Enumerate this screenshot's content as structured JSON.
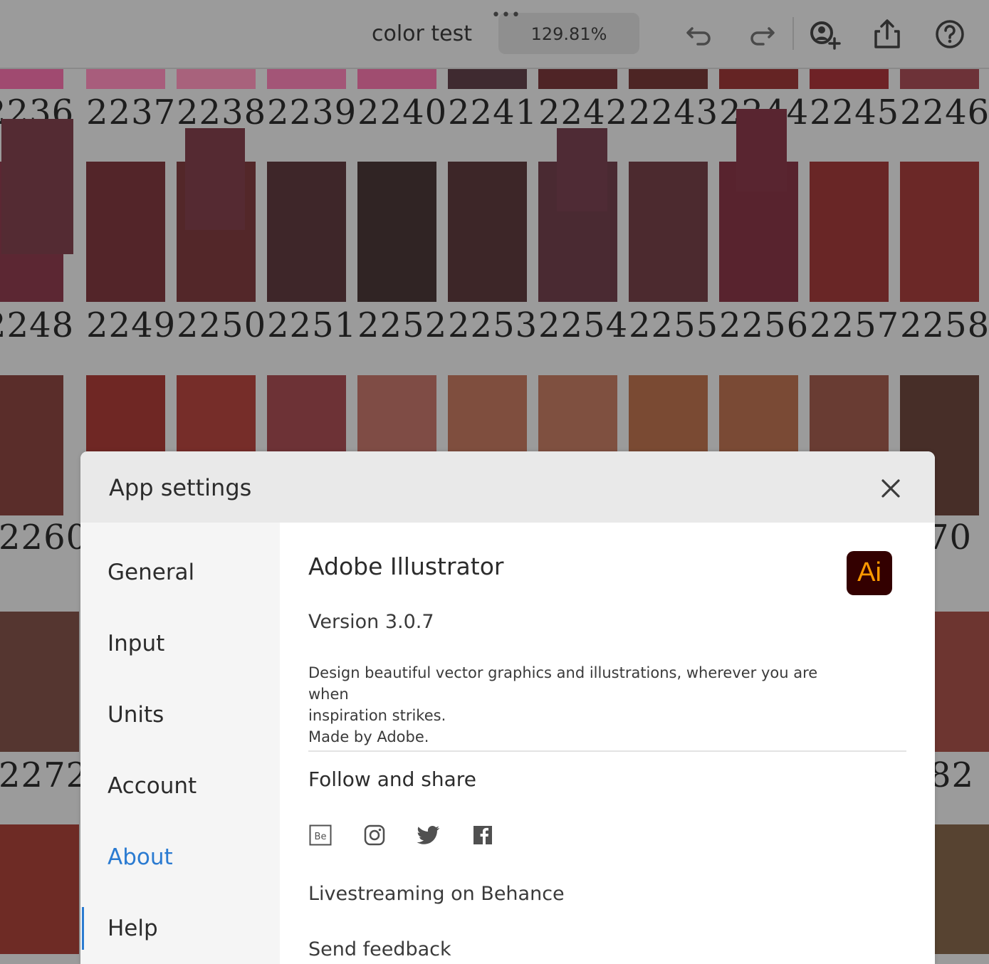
{
  "toolbar": {
    "doc_title": "color test",
    "more_dots": "•••",
    "zoom": "129.81%",
    "icons": [
      "undo-icon",
      "redo-icon",
      "invite-user-icon",
      "share-icon",
      "help-icon"
    ]
  },
  "canvas": {
    "row1_labels": [
      "2236",
      "2237",
      "2238",
      "2239",
      "2240",
      "2241",
      "2242",
      "2243",
      "2244",
      "2245",
      "2246"
    ],
    "row2_labels": [
      "2248",
      "2249",
      "2250",
      "2251",
      "2252",
      "2253",
      "2254",
      "2255",
      "2256",
      "2257",
      "2258"
    ],
    "row3_left": "2260",
    "row3_right": "70",
    "row4_left": "2272",
    "row4_right": "82",
    "top_colors": [
      "#a04a70",
      "#a85d7c",
      "#a8627c",
      "#a35577",
      "#a04d70",
      "#3f2a30",
      "#4f2426",
      "#4d2524",
      "#652424",
      "#6e2226",
      "#6d3238"
    ],
    "row2_colors": [
      "#5c2733",
      "#532529",
      "#532729",
      "#3e2629",
      "#302424",
      "#3d2628",
      "#4a2a32",
      "#4c2a2f",
      "#58232e",
      "#692626",
      "#6b2827"
    ],
    "row2_overlay_colors": [
      "#542b33",
      "#552a32",
      "#4f2b35",
      "#592530"
    ],
    "row3_colors": [
      "#5a2d2a",
      "#6f2724",
      "#762d29",
      "#6d3236",
      "#7f4c45",
      "#7f4e3e",
      "#7f5040",
      "#7a4a33",
      "#7a4a35",
      "#693c33",
      "#472e28"
    ],
    "row4_left_color": "#553630",
    "row4_right_color": "#6d3530",
    "row5_left_color": "#6e2b25",
    "row5_right_color": "#574331"
  },
  "dialog": {
    "title": "App settings",
    "nav": [
      {
        "label": "General"
      },
      {
        "label": "Input"
      },
      {
        "label": "Units"
      },
      {
        "label": "Account"
      },
      {
        "label": "About"
      },
      {
        "label": "Help"
      }
    ],
    "active_nav": "About",
    "accent_color": "#2b7bd1",
    "about": {
      "app_name": "Adobe Illustrator",
      "logo_text": "Ai",
      "version": "Version 3.0.7",
      "description_line1": "Design beautiful vector graphics and illustrations, wherever you are when",
      "description_line2": "inspiration strikes.",
      "description_line3": "Made by Adobe.",
      "follow_heading": "Follow and share",
      "social_icons": [
        "behance-icon",
        "instagram-icon",
        "twitter-icon",
        "facebook-icon"
      ],
      "links": [
        {
          "label": "Livestreaming on Behance"
        },
        {
          "label": "Send feedback"
        }
      ]
    }
  }
}
